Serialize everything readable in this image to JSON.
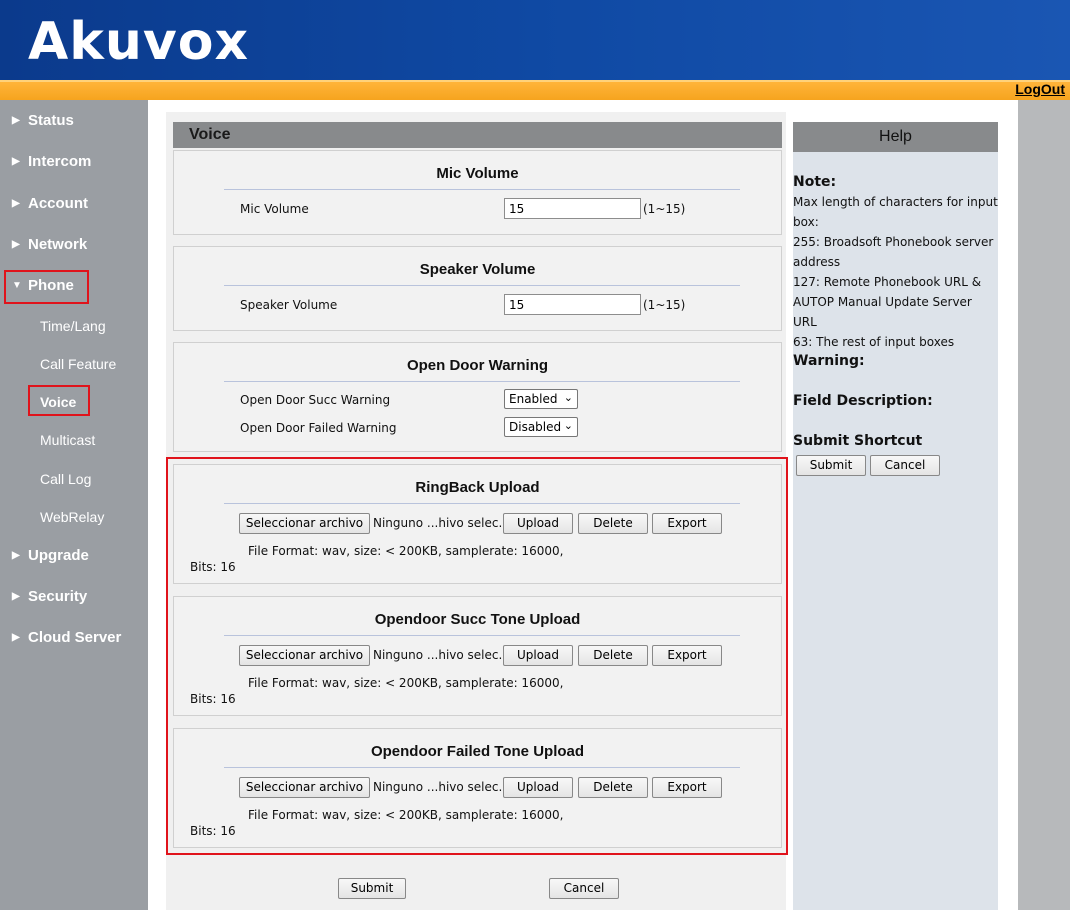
{
  "header": {
    "logo": "Akuvox",
    "logout": "LogOut"
  },
  "sidebar": {
    "items": [
      {
        "label": "Status"
      },
      {
        "label": "Intercom"
      },
      {
        "label": "Account"
      },
      {
        "label": "Network"
      },
      {
        "label": "Phone"
      },
      {
        "label": "Upgrade"
      },
      {
        "label": "Security"
      },
      {
        "label": "Cloud Server"
      }
    ],
    "sub": [
      {
        "label": "Time/Lang"
      },
      {
        "label": "Call Feature"
      },
      {
        "label": "Voice"
      },
      {
        "label": "Multicast"
      },
      {
        "label": "Call Log"
      },
      {
        "label": "WebRelay"
      }
    ]
  },
  "page": {
    "title": "Voice"
  },
  "mic": {
    "title": "Mic Volume",
    "label": "Mic Volume",
    "value": "15",
    "range": "(1~15)"
  },
  "speaker": {
    "title": "Speaker Volume",
    "label": "Speaker Volume",
    "value": "15",
    "range": "(1~15)"
  },
  "door": {
    "title": "Open Door Warning",
    "succ_label": "Open Door Succ Warning",
    "succ_value": "Enabled",
    "fail_label": "Open Door Failed Warning",
    "fail_value": "Disabled"
  },
  "uploads": [
    {
      "title": "RingBack Upload",
      "choose": "Seleccionar archivo",
      "file": "Ninguno ...hivo selec.",
      "upload": "Upload",
      "delete": "Delete",
      "export": "Export",
      "format": "File Format: wav, size: < 200KB, samplerate: 16000,",
      "bits": "Bits: 16"
    },
    {
      "title": "Opendoor Succ Tone Upload",
      "choose": "Seleccionar archivo",
      "file": "Ninguno ...hivo selec.",
      "upload": "Upload",
      "delete": "Delete",
      "export": "Export",
      "format": "File Format: wav, size: < 200KB, samplerate: 16000,",
      "bits": "Bits: 16"
    },
    {
      "title": "Opendoor Failed Tone Upload",
      "choose": "Seleccionar archivo",
      "file": "Ninguno ...hivo selec.",
      "upload": "Upload",
      "delete": "Delete",
      "export": "Export",
      "format": "File Format: wav, size: < 200KB, samplerate: 16000,",
      "bits": "Bits: 16"
    }
  ],
  "actions": {
    "submit": "Submit",
    "cancel": "Cancel"
  },
  "help": {
    "title": "Help",
    "note_label": "Note:",
    "note_lines": [
      "Max length of characters for input",
      "box:",
      "255: Broadsoft Phonebook server",
      "address",
      "127: Remote Phonebook URL &",
      "AUTOP Manual Update Server URL",
      "63: The rest of input boxes"
    ],
    "warning_label": "Warning:",
    "field_label": "Field Description:",
    "shortcut_label": "Submit Shortcut",
    "submit": "Submit",
    "cancel": "Cancel"
  },
  "colors": {
    "highlight": "#e0131b",
    "header": "#0f49a3",
    "bar": "#f6a41e"
  }
}
